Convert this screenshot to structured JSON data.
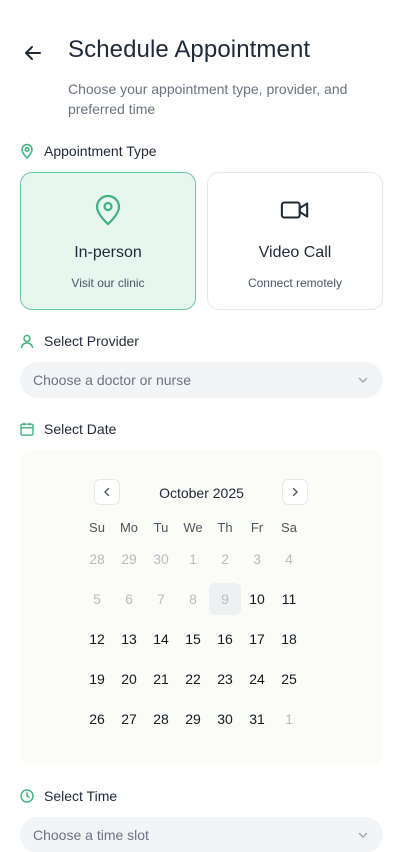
{
  "header": {
    "title": "Schedule Appointment",
    "subtitle": "Choose your appointment type, provider, and preferred time"
  },
  "appointment_type": {
    "label": "Appointment Type",
    "options": [
      {
        "title": "In-person",
        "subtitle": "Visit our clinic",
        "icon": "map-pin-icon",
        "selected": true
      },
      {
        "title": "Video Call",
        "subtitle": "Connect remotely",
        "icon": "video-camera-icon",
        "selected": false
      }
    ]
  },
  "provider": {
    "label": "Select Provider",
    "placeholder": "Choose a doctor or nurse"
  },
  "date": {
    "label": "Select Date",
    "month": "October 2025",
    "weekdays": [
      "Su",
      "Mo",
      "Tu",
      "We",
      "Th",
      "Fr",
      "Sa"
    ],
    "weeks": [
      [
        "28",
        "29",
        "30",
        "1",
        "2",
        "3",
        "4"
      ],
      [
        "5",
        "6",
        "7",
        "8",
        "9",
        "10",
        "11"
      ],
      [
        "12",
        "13",
        "14",
        "15",
        "16",
        "17",
        "18"
      ],
      [
        "19",
        "20",
        "21",
        "22",
        "23",
        "24",
        "25"
      ],
      [
        "26",
        "27",
        "28",
        "29",
        "30",
        "31",
        "1"
      ]
    ]
  },
  "time": {
    "label": "Select Time",
    "placeholder": "Choose a time slot"
  },
  "colors": {
    "accent": "#3fb27f",
    "selected_bg": "#e8f6f0",
    "muted_text": "#b8bcc3"
  }
}
